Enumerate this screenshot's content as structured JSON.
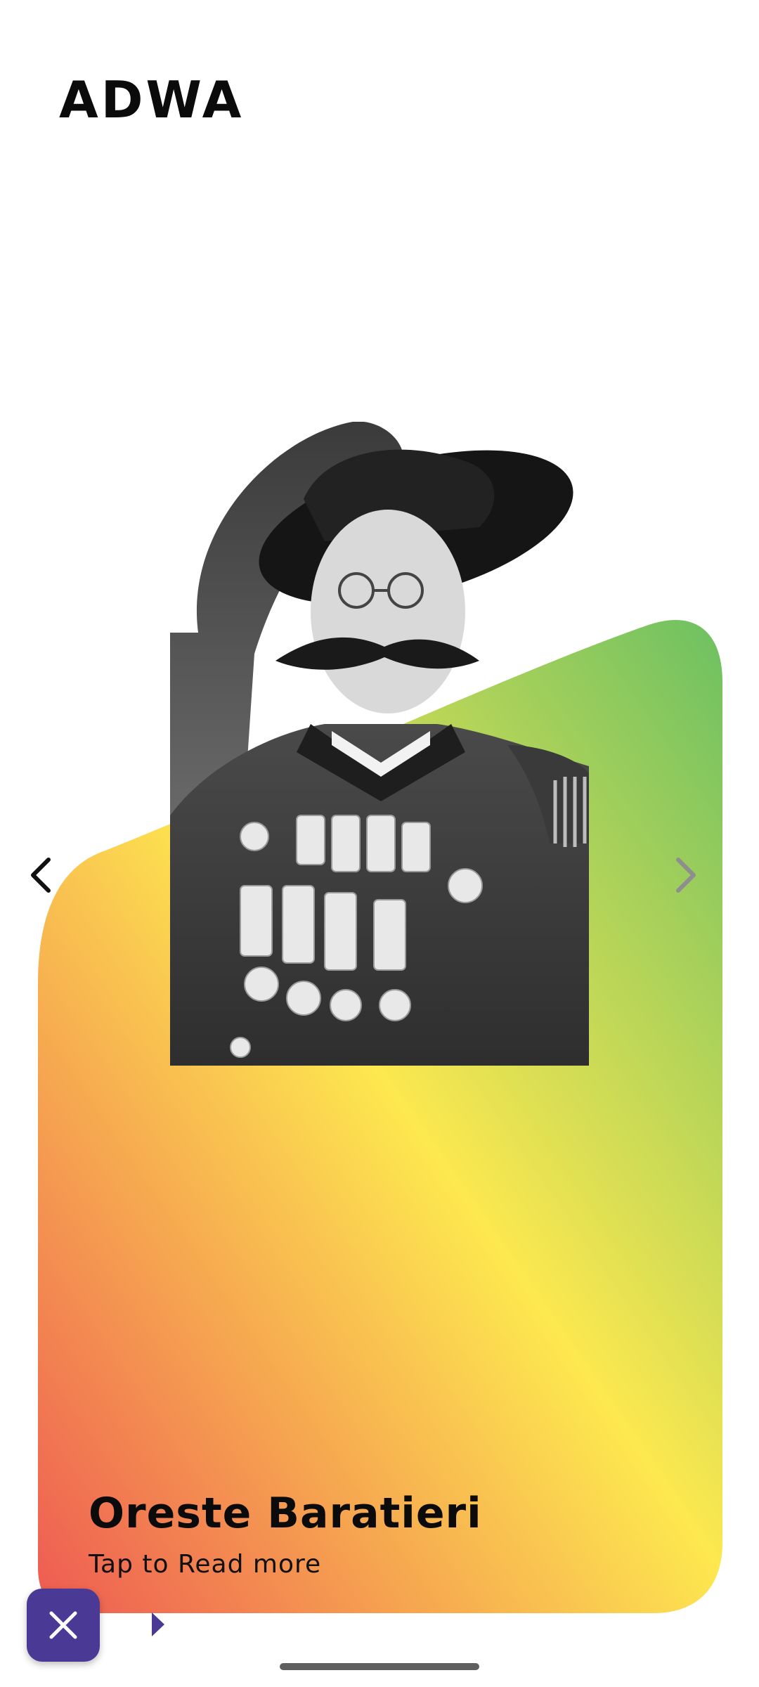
{
  "header": {
    "title": "ADWA"
  },
  "card": {
    "person_name": "Oreste Baratieri",
    "subtitle": "Tap to Read more",
    "gradient": {
      "top_right": "#6cc062",
      "middle": "#fde84f",
      "bottom_left": "#ee5a52"
    }
  },
  "controls": {
    "prev_icon": "chevron-left-icon",
    "next_icon": "chevron-right-icon",
    "close_icon": "close-icon",
    "play_icon": "play-triangle-icon",
    "accent_color": "#4a3a96"
  }
}
